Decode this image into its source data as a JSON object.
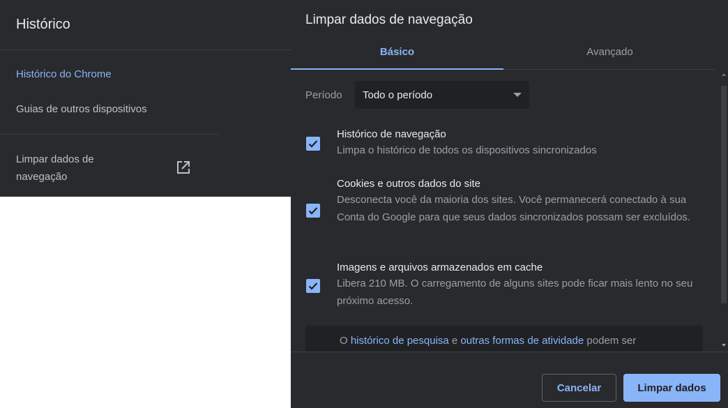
{
  "sidebar": {
    "title": "Histórico",
    "items": [
      {
        "label": "Histórico do Chrome",
        "active": true
      },
      {
        "label": "Guias de outros dispositivos",
        "active": false
      }
    ],
    "clear_link": {
      "label": "Limpar dados de navegação",
      "icon": "open-in-new-icon"
    }
  },
  "dialog": {
    "title": "Limpar dados de navegação",
    "tabs": [
      {
        "label": "Básico",
        "active": true
      },
      {
        "label": "Avançado",
        "active": false
      }
    ],
    "period": {
      "label": "Período",
      "value": "Todo o período"
    },
    "options": [
      {
        "title": "Histórico de navegação",
        "description": "Limpa o histórico de todos os dispositivos sincronizados",
        "checked": true
      },
      {
        "title": "Cookies e outros dados do site",
        "description": "Desconecta você da maioria dos sites. Você permanecerá conectado à sua Conta do Google para que seus dados sincronizados possam ser excluídos.",
        "checked": true
      },
      {
        "title": "Imagens e arquivos armazenados em cache",
        "description": "Libera 210 MB. O carregamento de alguns sites pode ficar mais lento no seu próximo acesso.",
        "checked": true
      }
    ],
    "info": {
      "prefix": "O ",
      "link1": "histórico de pesquisa",
      "middle": " e ",
      "link2": "outras formas de atividade",
      "suffix": " podem ser"
    },
    "buttons": {
      "cancel": "Cancelar",
      "confirm": "Limpar dados"
    }
  },
  "colors": {
    "background": "#292a2d",
    "accent": "#8ab4f8",
    "text_primary": "#e8eaed",
    "text_secondary": "#9aa0a6"
  }
}
